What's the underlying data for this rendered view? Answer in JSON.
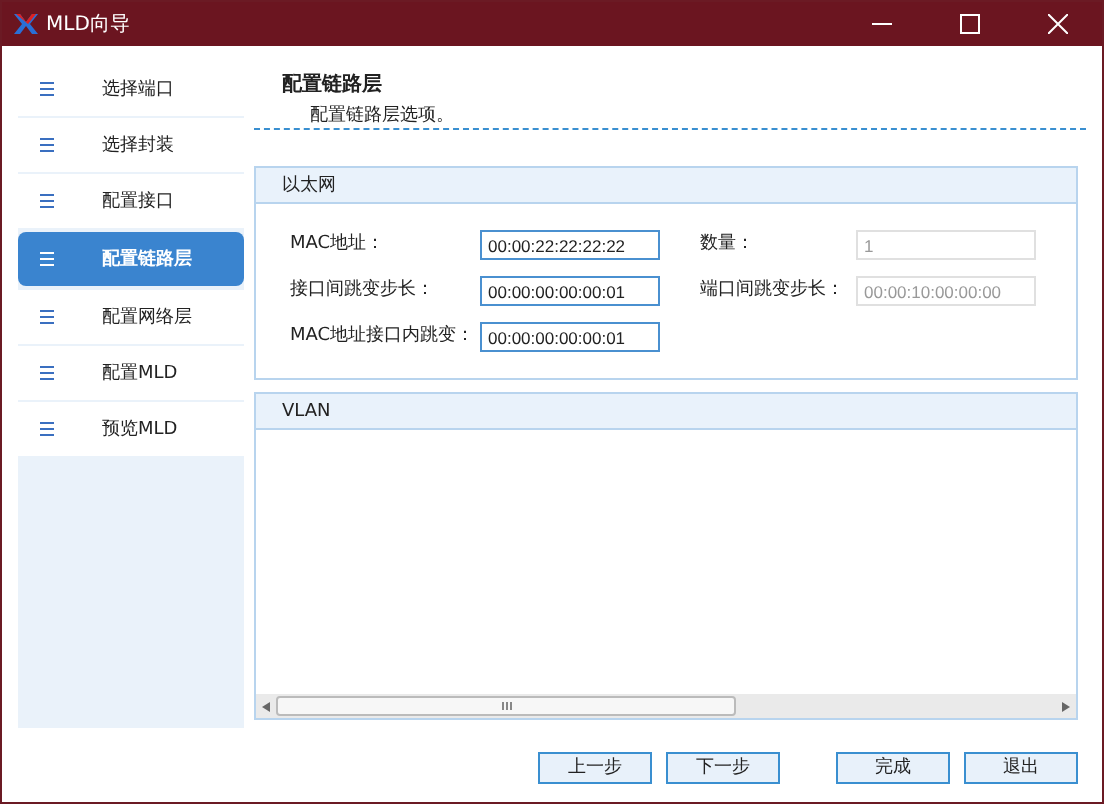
{
  "window": {
    "title": "MLD向导"
  },
  "sidebar": {
    "items": [
      {
        "label": "选择端口",
        "selected": false
      },
      {
        "label": "选择封装",
        "selected": false
      },
      {
        "label": "配置接口",
        "selected": false
      },
      {
        "label": "配置链路层",
        "selected": true
      },
      {
        "label": "配置网络层",
        "selected": false
      },
      {
        "label": "配置MLD",
        "selected": false
      },
      {
        "label": "预览MLD",
        "selected": false
      }
    ]
  },
  "header": {
    "title": "配置链路层",
    "subtitle": "配置链路层选项。"
  },
  "ethernet": {
    "title": "以太网",
    "fields": [
      {
        "label": "MAC地址：",
        "value": "00:00:22:22:22:22",
        "disabled": false
      },
      {
        "label": "数量：",
        "value": "1",
        "disabled": true
      },
      {
        "label": "接口间跳变步长：",
        "value": "00:00:00:00:00:01",
        "disabled": false
      },
      {
        "label": "端口间跳变步长：",
        "value": "00:00:10:00:00:00",
        "disabled": true
      },
      {
        "label": "MAC地址接口内跳变：",
        "value": "00:00:00:00:00:01",
        "disabled": false
      }
    ]
  },
  "vlan": {
    "title": "VLAN"
  },
  "buttons": [
    "上一步",
    "下一步",
    "完成",
    "退出"
  ]
}
